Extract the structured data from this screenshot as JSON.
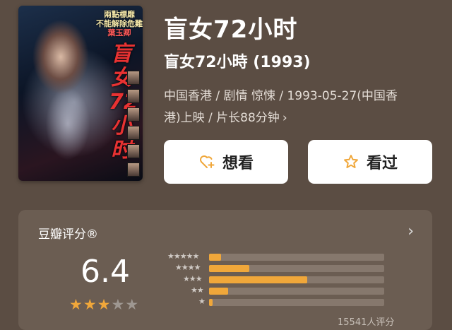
{
  "poster": {
    "text_lines": [
      "兩點標靡",
      "不能解除危難",
      "葉玉卿"
    ],
    "vertical_title": "盲女72小时"
  },
  "movie": {
    "title": "盲女72小时",
    "original_title": "盲女72小時 (1993)",
    "meta_line1": "中国香港 / 剧情 惊悚 / 1993-05-27(中国香",
    "meta_line2": "港)上映 / 片长88分钟"
  },
  "actions": {
    "want_label": "想看",
    "seen_label": "看过"
  },
  "rating": {
    "label": "豆瓣评分®",
    "score": "6.4",
    "stars_filled": 3,
    "stars_total": 5,
    "distribution": [
      {
        "stars": 5,
        "fraction": 0.07
      },
      {
        "stars": 4,
        "fraction": 0.23
      },
      {
        "stars": 3,
        "fraction": 0.56
      },
      {
        "stars": 2,
        "fraction": 0.11
      },
      {
        "stars": 1,
        "fraction": 0.02
      }
    ],
    "votes_text": "15541人评分"
  },
  "colors": {
    "background": "#5b4d43",
    "accent": "#f0a73a",
    "button_bg": "#ffffff"
  },
  "icons": {
    "want": "heart-plus-icon",
    "seen": "star-outline-icon",
    "chevron": "chevron-right-icon"
  }
}
